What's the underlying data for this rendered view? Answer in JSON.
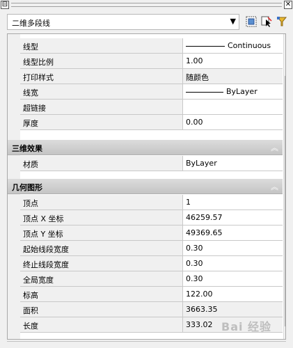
{
  "titlebar": {
    "minimize_glyph": "⊟",
    "close_glyph": "✕"
  },
  "toolbar": {
    "object_type": "二维多段线",
    "dropdown_icon": "chevron-down-icon",
    "buttons": [
      "quick-select-icon",
      "select-objects-icon",
      "pickadd-toggle-icon"
    ]
  },
  "general": {
    "linetype": {
      "label": "线型",
      "value": "Continuous"
    },
    "linetype_scale": {
      "label": "线型比例",
      "value": "1.00"
    },
    "plot_style": {
      "label": "打印样式",
      "value": "随颜色"
    },
    "lineweight": {
      "label": "线宽",
      "value": "ByLayer"
    },
    "hyperlink": {
      "label": "超链接",
      "value": ""
    },
    "thickness": {
      "label": "厚度",
      "value": "0.00"
    }
  },
  "effects_3d": {
    "title": "三维效果",
    "material": {
      "label": "材质",
      "value": "ByLayer"
    }
  },
  "geometry": {
    "title": "几何图形",
    "vertex": {
      "label": "顶点",
      "value": "1"
    },
    "vertex_x": {
      "label": "顶点 X 坐标",
      "value": "46259.57"
    },
    "vertex_y": {
      "label": "顶点 Y 坐标",
      "value": "49369.65"
    },
    "start_width": {
      "label": "起始线段宽度",
      "value": "0.30"
    },
    "end_width": {
      "label": "终止线段宽度",
      "value": "0.30"
    },
    "global_width": {
      "label": "全局宽度",
      "value": "0.30"
    },
    "elevation": {
      "label": "标高",
      "value": "122.00"
    },
    "area": {
      "label": "面积",
      "value": "3663.35"
    },
    "length": {
      "label": "长度",
      "value": "333.02"
    }
  },
  "watermark": "Bai 经验",
  "colors": {
    "panel_bg": "#f0f0f0",
    "group_header": "#c8c8c8",
    "grid_line": "#c8c8c8"
  }
}
